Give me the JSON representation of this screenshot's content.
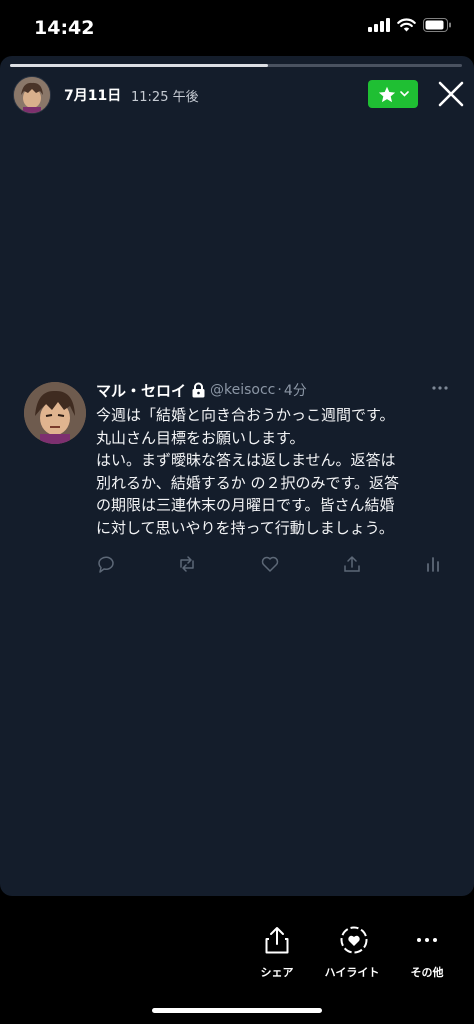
{
  "status_bar": {
    "time": "14:42"
  },
  "story": {
    "progress": 0.57,
    "date": "7月11日",
    "time": "11:25 午後",
    "accent_color": "#1fbf33"
  },
  "tweet": {
    "name": "マル・セロイ",
    "handle": "@keisocc",
    "separator": "·",
    "time": "4分",
    "lines": [
      "今週は「結婚と向き合おうかっこ週間です。",
      "丸山さん目標をお願いします。",
      "はい。まず曖昧な答えは返しません。返答は",
      "別れるか、結婚するか の２択のみです。返答",
      "の期限は三連休末の月曜日です。皆さん結婚",
      "に対して思いやりを持って行動しましょう。"
    ]
  },
  "bottom_bar": {
    "share_label": "シェア",
    "highlight_label": "ハイライト",
    "other_label": "その他"
  }
}
